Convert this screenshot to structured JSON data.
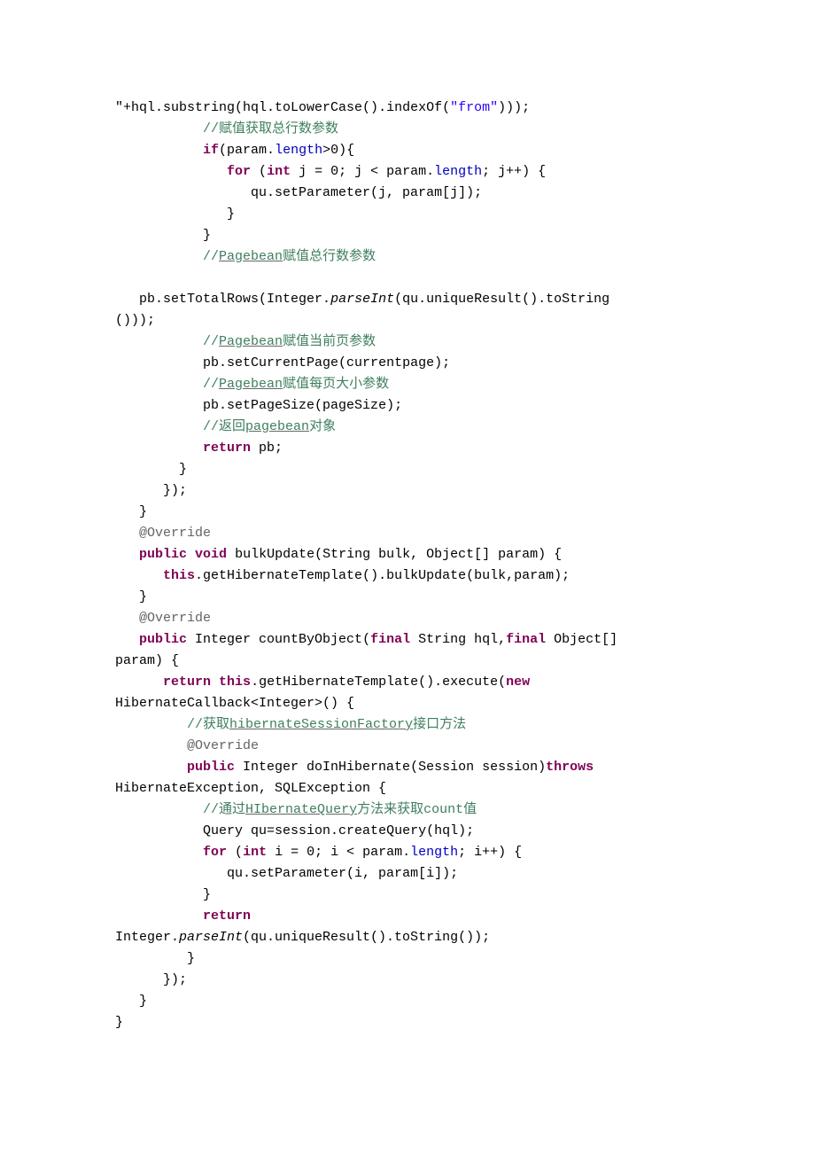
{
  "code_lines": [
    {
      "indent": "",
      "segments": [
        {
          "t": "plain",
          "v": "\""
        },
        {
          "t": "plain",
          "v": "+hql.substring(hql.toLowerCase().indexOf("
        },
        {
          "t": "str",
          "v": "\"from\""
        },
        {
          "t": "plain",
          "v": ")));"
        }
      ]
    },
    {
      "indent": "           ",
      "segments": [
        {
          "t": "cmt",
          "v": "//赋值获取总行数参数"
        }
      ]
    },
    {
      "indent": "           ",
      "segments": [
        {
          "t": "kw",
          "v": "if"
        },
        {
          "t": "plain",
          "v": "(param."
        },
        {
          "t": "field",
          "v": "length"
        },
        {
          "t": "plain",
          "v": ">0){"
        }
      ]
    },
    {
      "indent": "              ",
      "segments": [
        {
          "t": "kw",
          "v": "for"
        },
        {
          "t": "plain",
          "v": " ("
        },
        {
          "t": "kw",
          "v": "int"
        },
        {
          "t": "plain",
          "v": " j = 0; j < param."
        },
        {
          "t": "field",
          "v": "length"
        },
        {
          "t": "plain",
          "v": "; j++) {"
        }
      ]
    },
    {
      "indent": "                 ",
      "segments": [
        {
          "t": "plain",
          "v": "qu.setParameter(j, param[j]);"
        }
      ]
    },
    {
      "indent": "              ",
      "segments": [
        {
          "t": "plain",
          "v": "}"
        }
      ]
    },
    {
      "indent": "           ",
      "segments": [
        {
          "t": "plain",
          "v": "}"
        }
      ]
    },
    {
      "indent": "           ",
      "segments": [
        {
          "t": "cmt",
          "v": "//"
        },
        {
          "t": "cmt-und",
          "v": "Pagebean"
        },
        {
          "t": "cmt",
          "v": "赋值总行数参数"
        }
      ]
    },
    {
      "indent": "",
      "segments": [
        {
          "t": "plain",
          "v": "   "
        }
      ]
    },
    {
      "indent": "   ",
      "segments": [
        {
          "t": "plain",
          "v": "pb.setTotalRows(Integer."
        },
        {
          "t": "static-italic",
          "v": "parseInt"
        },
        {
          "t": "plain",
          "v": "(qu.uniqueResult().toString"
        }
      ]
    },
    {
      "indent": "",
      "segments": [
        {
          "t": "plain",
          "v": "()));"
        }
      ]
    },
    {
      "indent": "           ",
      "segments": [
        {
          "t": "cmt",
          "v": "//"
        },
        {
          "t": "cmt-und",
          "v": "Pagebean"
        },
        {
          "t": "cmt",
          "v": "赋值当前页参数"
        }
      ]
    },
    {
      "indent": "           ",
      "segments": [
        {
          "t": "plain",
          "v": "pb.setCurrentPage(currentpage);"
        }
      ]
    },
    {
      "indent": "           ",
      "segments": [
        {
          "t": "cmt",
          "v": "//"
        },
        {
          "t": "cmt-und",
          "v": "Pagebean"
        },
        {
          "t": "cmt",
          "v": "赋值每页大小参数"
        }
      ]
    },
    {
      "indent": "           ",
      "segments": [
        {
          "t": "plain",
          "v": "pb.setPageSize(pageSize);"
        }
      ]
    },
    {
      "indent": "           ",
      "segments": [
        {
          "t": "cmt",
          "v": "//返回"
        },
        {
          "t": "cmt-und",
          "v": "pagebean"
        },
        {
          "t": "cmt",
          "v": "对象"
        }
      ]
    },
    {
      "indent": "           ",
      "segments": [
        {
          "t": "kw",
          "v": "return"
        },
        {
          "t": "plain",
          "v": " pb;"
        }
      ]
    },
    {
      "indent": "        ",
      "segments": [
        {
          "t": "plain",
          "v": "}"
        }
      ]
    },
    {
      "indent": "      ",
      "segments": [
        {
          "t": "plain",
          "v": "});"
        }
      ]
    },
    {
      "indent": "   ",
      "segments": [
        {
          "t": "plain",
          "v": "}"
        }
      ]
    },
    {
      "indent": "   ",
      "segments": [
        {
          "t": "ann",
          "v": "@Override"
        }
      ]
    },
    {
      "indent": "   ",
      "segments": [
        {
          "t": "kw",
          "v": "public"
        },
        {
          "t": "plain",
          "v": " "
        },
        {
          "t": "kw",
          "v": "void"
        },
        {
          "t": "plain",
          "v": " bulkUpdate(String bulk, Object[] param) {"
        }
      ]
    },
    {
      "indent": "      ",
      "segments": [
        {
          "t": "kw",
          "v": "this"
        },
        {
          "t": "plain",
          "v": ".getHibernateTemplate().bulkUpdate(bulk,param);"
        }
      ]
    },
    {
      "indent": "   ",
      "segments": [
        {
          "t": "plain",
          "v": "}"
        }
      ]
    },
    {
      "indent": "   ",
      "segments": [
        {
          "t": "ann",
          "v": "@Override"
        }
      ]
    },
    {
      "indent": "   ",
      "segments": [
        {
          "t": "kw",
          "v": "public"
        },
        {
          "t": "plain",
          "v": " Integer countByObject("
        },
        {
          "t": "kw",
          "v": "final"
        },
        {
          "t": "plain",
          "v": " String hql,"
        },
        {
          "t": "kw",
          "v": "final"
        },
        {
          "t": "plain",
          "v": " Object[] "
        }
      ]
    },
    {
      "indent": "",
      "segments": [
        {
          "t": "plain",
          "v": "param) {"
        }
      ]
    },
    {
      "indent": "      ",
      "segments": [
        {
          "t": "kw",
          "v": "return"
        },
        {
          "t": "plain",
          "v": " "
        },
        {
          "t": "kw",
          "v": "this"
        },
        {
          "t": "plain",
          "v": ".getHibernateTemplate().execute("
        },
        {
          "t": "kw",
          "v": "new"
        },
        {
          "t": "plain",
          "v": " "
        }
      ]
    },
    {
      "indent": "",
      "segments": [
        {
          "t": "plain",
          "v": "HibernateCallback<Integer>() {"
        }
      ]
    },
    {
      "indent": "         ",
      "segments": [
        {
          "t": "cmt",
          "v": "//获取"
        },
        {
          "t": "cmt-und",
          "v": "hibernateSessionFactory"
        },
        {
          "t": "cmt",
          "v": "接口方法"
        }
      ]
    },
    {
      "indent": "         ",
      "segments": [
        {
          "t": "ann",
          "v": "@Override"
        }
      ]
    },
    {
      "indent": "         ",
      "segments": [
        {
          "t": "kw",
          "v": "public"
        },
        {
          "t": "plain",
          "v": " Integer doInHibernate(Session session)"
        },
        {
          "t": "kw",
          "v": "throws"
        },
        {
          "t": "plain",
          "v": " "
        }
      ]
    },
    {
      "indent": "",
      "segments": [
        {
          "t": "plain",
          "v": "HibernateException, SQLException {"
        }
      ]
    },
    {
      "indent": "           ",
      "segments": [
        {
          "t": "cmt",
          "v": "//通过"
        },
        {
          "t": "cmt-und",
          "v": "HIbernateQuery"
        },
        {
          "t": "cmt",
          "v": "方法来获取count值"
        }
      ]
    },
    {
      "indent": "           ",
      "segments": [
        {
          "t": "plain",
          "v": "Query qu=session.createQuery(hql);"
        }
      ]
    },
    {
      "indent": "           ",
      "segments": [
        {
          "t": "kw",
          "v": "for"
        },
        {
          "t": "plain",
          "v": " ("
        },
        {
          "t": "kw",
          "v": "int"
        },
        {
          "t": "plain",
          "v": " i = 0; i < param."
        },
        {
          "t": "field",
          "v": "length"
        },
        {
          "t": "plain",
          "v": "; i++) {"
        }
      ]
    },
    {
      "indent": "              ",
      "segments": [
        {
          "t": "plain",
          "v": "qu.setParameter(i, param[i]);"
        }
      ]
    },
    {
      "indent": "           ",
      "segments": [
        {
          "t": "plain",
          "v": "}"
        }
      ]
    },
    {
      "indent": "           ",
      "segments": [
        {
          "t": "kw",
          "v": "return"
        },
        {
          "t": "plain",
          "v": " "
        }
      ]
    },
    {
      "indent": "",
      "segments": [
        {
          "t": "plain",
          "v": "Integer."
        },
        {
          "t": "static-italic",
          "v": "parseInt"
        },
        {
          "t": "plain",
          "v": "(qu.uniqueResult().toString());"
        }
      ]
    },
    {
      "indent": "         ",
      "segments": [
        {
          "t": "plain",
          "v": "}"
        }
      ]
    },
    {
      "indent": "      ",
      "segments": [
        {
          "t": "plain",
          "v": "});"
        }
      ]
    },
    {
      "indent": "   ",
      "segments": [
        {
          "t": "plain",
          "v": "}"
        }
      ]
    },
    {
      "indent": "",
      "segments": [
        {
          "t": "plain",
          "v": "}"
        }
      ]
    }
  ]
}
